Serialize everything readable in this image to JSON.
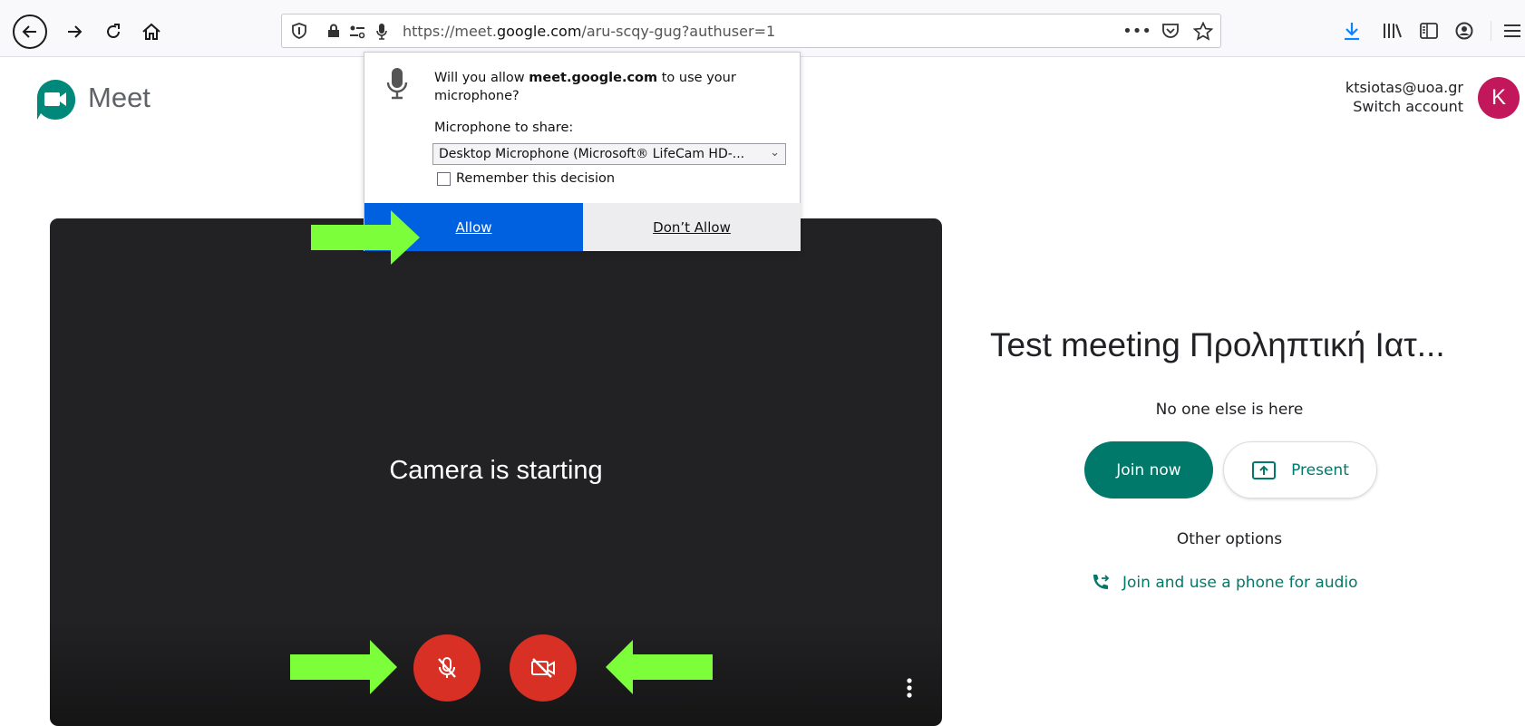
{
  "browser": {
    "url_prefix": "https://meet.",
    "url_domain": "google.com",
    "url_path": "/aru-scqy-gug?authuser=1",
    "icons": [
      "back-icon",
      "forward-icon",
      "reload-icon",
      "home-icon",
      "shield-icon",
      "lock-icon",
      "permissions-icon",
      "microphone-icon",
      "more-icon",
      "pocket-icon",
      "star-icon",
      "download-icon",
      "library-icon",
      "sidebar-icon",
      "account-icon",
      "menu-icon"
    ]
  },
  "permission_popup": {
    "message_prefix": "Will you allow ",
    "message_domain": "meet.google.com",
    "message_suffix": " to use your microphone?",
    "device_label": "Microphone to share:",
    "selected_device": "Desktop Microphone (Microsoft® LifeCam HD-...",
    "remember_label": "Remember this decision",
    "allow_label": "Allow",
    "deny_label": "Don’t Allow"
  },
  "meet": {
    "app_name": "Meet",
    "account_email": "ktsiotas@uoa.gr",
    "switch_account": "Switch account",
    "avatar_letter": "K",
    "camera_status": "Camera is starting",
    "meeting_title": "Test meeting Προληπτική Ιατ...",
    "participants_status": "No one else is here",
    "join_now": "Join now",
    "present": "Present",
    "other_options": "Other options",
    "phone_audio": "Join and use a phone for audio"
  },
  "colors": {
    "meet_green": "#00796b",
    "allow_blue": "#0061e0",
    "mute_red": "#d93025",
    "avatar": "#c2185b",
    "annotation_arrow": "#7cff3a"
  }
}
